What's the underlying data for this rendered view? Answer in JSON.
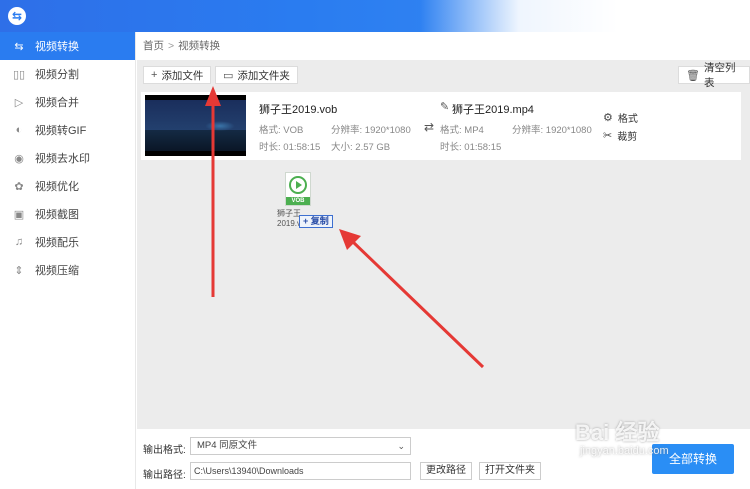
{
  "sidebar": {
    "items": [
      {
        "label": "视频转换",
        "icon": "convert-icon",
        "active": true
      },
      {
        "label": "视频分割",
        "icon": "split-icon"
      },
      {
        "label": "视频合并",
        "icon": "merge-icon"
      },
      {
        "label": "视频转GIF",
        "icon": "gif-icon"
      },
      {
        "label": "视频去水印",
        "icon": "watermark-icon"
      },
      {
        "label": "视频优化",
        "icon": "optimize-icon"
      },
      {
        "label": "视频截图",
        "icon": "screenshot-icon"
      },
      {
        "label": "视频配乐",
        "icon": "music-icon"
      },
      {
        "label": "视频压缩",
        "icon": "compress-icon"
      }
    ]
  },
  "breadcrumb": {
    "home": "首页",
    "separator": ">",
    "current": "视频转换"
  },
  "toolbar": {
    "add_file": "添加文件",
    "add_folder": "添加文件夹",
    "clear_list": "清空列表"
  },
  "file": {
    "source_name": "狮子王2019.vob",
    "source_format_label": "格式:",
    "source_format": "VOB",
    "source_resolution_label": "分辨率:",
    "source_resolution": "1920*1080",
    "source_duration_label": "时长:",
    "source_duration": "01:58:15",
    "source_size_label": "大小:",
    "source_size": "2.57 GB",
    "target_name": "狮子王2019.mp4",
    "target_format_label": "格式:",
    "target_format": "MP4",
    "target_resolution_label": "分辨率:",
    "target_resolution": "1920*1080",
    "target_duration_label": "时长:",
    "target_duration": "01:58:15",
    "action_format": "格式",
    "action_cut": "裁剪"
  },
  "drag": {
    "file_tag": "VOB",
    "name_line1": "狮子王",
    "name_line2": "2019.vob",
    "copy_label": "+ 复制"
  },
  "bottom": {
    "format_label": "输出格式:",
    "format_value": "MP4  同原文件",
    "path_label": "输出路径:",
    "path_value": "C:\\Users\\13940\\Downloads",
    "change_path": "更改路径",
    "open_folder": "打开文件夹",
    "convert_all": "全部转换"
  },
  "watermark": {
    "line1": "Bai 经验",
    "line2": "jingyan.baidu.com"
  },
  "colors": {
    "accent": "#2a7cf0",
    "arrow": "#e53935",
    "drag_green": "#4caf50"
  }
}
